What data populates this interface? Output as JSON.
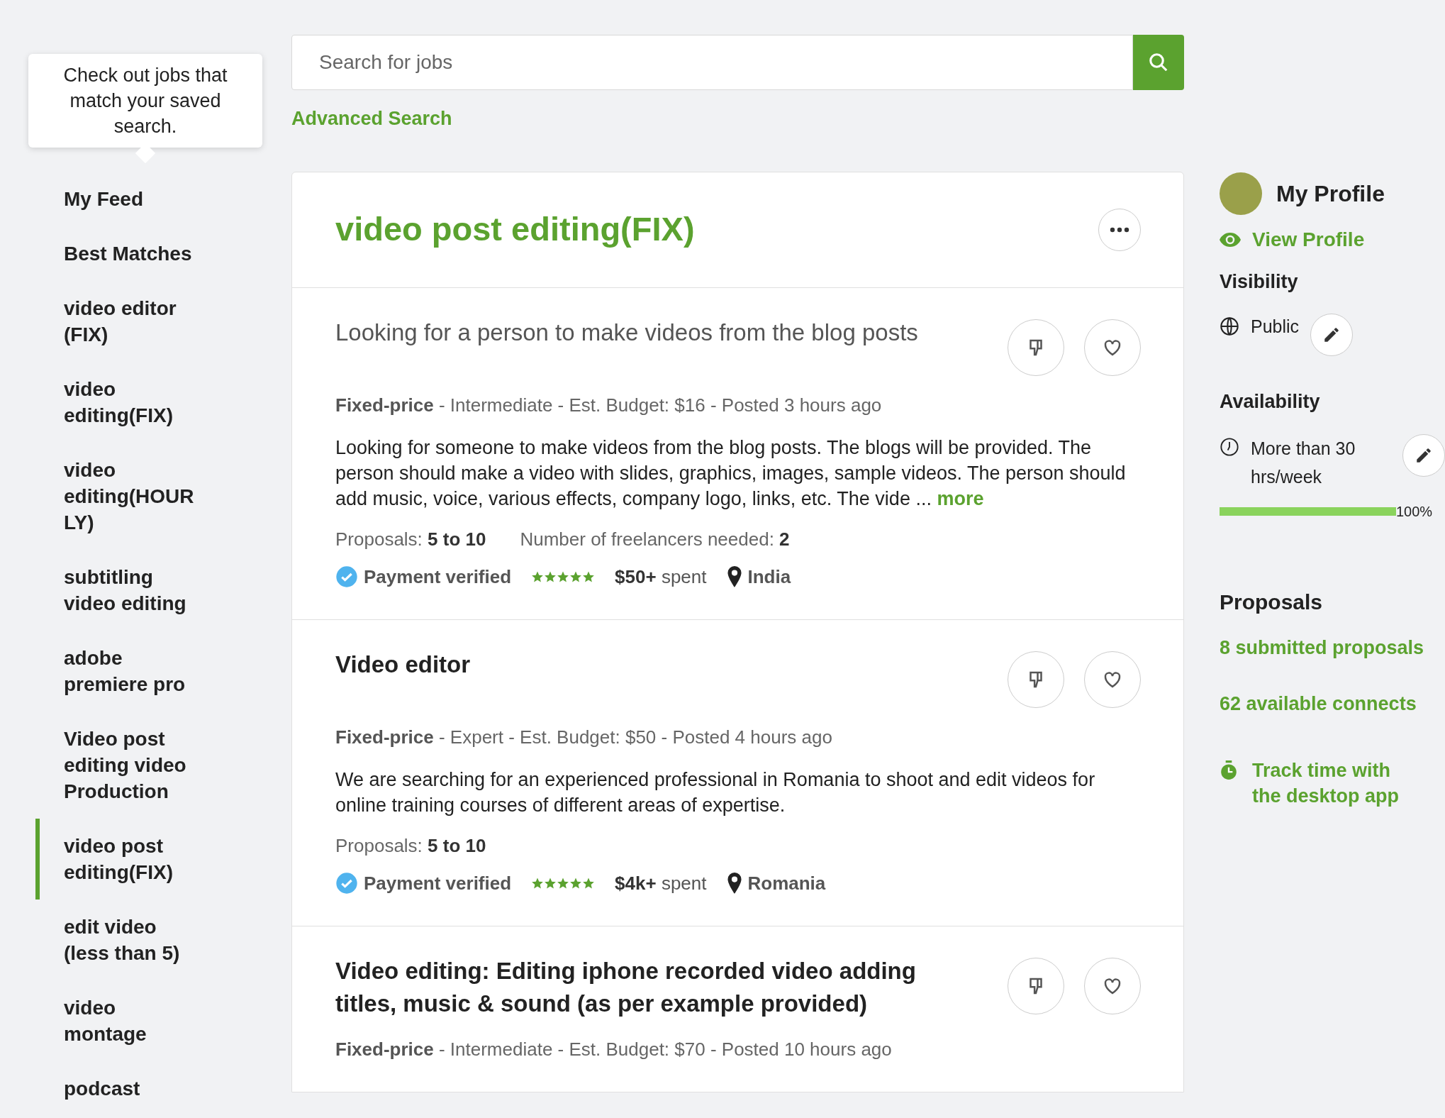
{
  "tooltip": {
    "text": "Check out jobs that match your saved search."
  },
  "sidebar": {
    "items": [
      {
        "label": "My Feed",
        "selected": false
      },
      {
        "label": "Best Matches",
        "selected": false
      },
      {
        "label": "video editor (FIX)",
        "selected": false
      },
      {
        "label": "video editing(FIX)",
        "selected": false
      },
      {
        "label": "video editing(HOURLY)",
        "selected": false
      },
      {
        "label": "subtitling video editing",
        "selected": false
      },
      {
        "label": "adobe premiere pro",
        "selected": false
      },
      {
        "label": "Video post editing video Production",
        "selected": false
      },
      {
        "label": "video post editing(FIX)",
        "selected": true
      },
      {
        "label": "edit video (less than 5)",
        "selected": false
      },
      {
        "label": "video montage",
        "selected": false
      },
      {
        "label": "podcast",
        "selected": false
      }
    ]
  },
  "search": {
    "placeholder": "Search for jobs",
    "advanced_link": "Advanced Search"
  },
  "feed": {
    "title": "video post editing(FIX)",
    "jobs": [
      {
        "title": "Looking for a person to make videos from the blog posts",
        "kind": "muted",
        "meta": "**Fixed-price** - Intermediate - Est. Budget: $16 - Posted 3 hours ago",
        "description": "Looking for someone to make videos from the blog posts. The blogs will be provided. The person should make a video with slides, graphics, images, sample videos. The person should add music, voice, various effects, company logo, links, etc. The vide ...",
        "more": "more",
        "proposals": "Proposals: **5 to 10**",
        "freelancers": "Number of freelancers needed: **2**",
        "payment": "Payment verified",
        "stars": 5,
        "spent": "**$50+** spent",
        "country": "India"
      },
      {
        "title": "Video editor",
        "kind": "bold",
        "meta": "**Fixed-price** - Expert - Est. Budget: $50 - Posted 4 hours ago",
        "description": "We are searching for an experienced professional in Romania to shoot and edit videos for online training courses of different areas of expertise.",
        "proposals": "Proposals: **5 to 10**",
        "payment": "Payment verified",
        "stars": 5,
        "spent": "**$4k+** spent",
        "country": "Romania"
      },
      {
        "title": "Video editing: Editing iphone recorded video adding titles, music & sound (as per example provided)",
        "kind": "bold",
        "meta": "**Fixed-price** - Intermediate - Est. Budget: $70 - Posted 10 hours ago"
      }
    ]
  },
  "profile": {
    "title": "My Profile",
    "view_link": "View Profile",
    "visibility": {
      "heading": "Visibility",
      "value": "Public"
    },
    "availability": {
      "heading": "Availability",
      "value": "More than 30 hrs/week",
      "level": 1.0,
      "reading": "100%"
    },
    "proposals": {
      "heading": "Proposals",
      "submitted": "8 submitted proposals",
      "connects": "62 available connects"
    },
    "track_link": "Track time with the desktop app"
  }
}
